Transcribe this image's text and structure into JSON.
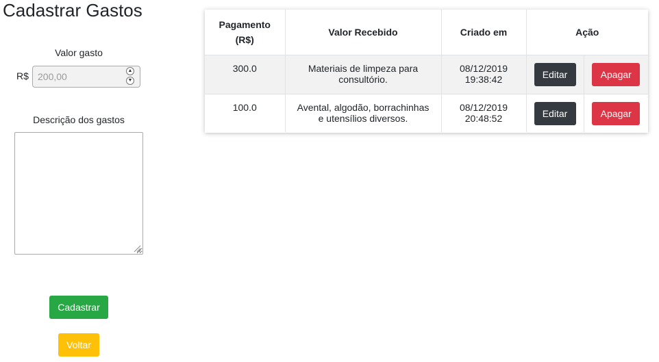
{
  "page": {
    "title": "Cadastrar Gastos"
  },
  "form": {
    "valor_label": "Valor gasto",
    "currency_prefix": "R$",
    "valor_placeholder": "200,00",
    "descricao_label": "Descrição dos gastos",
    "submit_label": "Cadastrar",
    "back_label": "Voltar"
  },
  "table": {
    "headers": {
      "pagamento_line1": "Pagamento",
      "pagamento_line2": "(R$)",
      "valor": "Valor Recebido",
      "criado": "Criado em",
      "acao": "Ação"
    },
    "rows": [
      {
        "pagamento": "300.0",
        "valor_line1": "Materiais de limpeza para",
        "valor_line2": "consultório.",
        "data": "08/12/2019",
        "hora": "19:38:42",
        "edit_label": "Editar",
        "delete_label": "Apagar"
      },
      {
        "pagamento": "100.0",
        "valor_line1": "Avental, algodão, borrachinhas",
        "valor_line2": "e utensílios diversos.",
        "data": "08/12/2019",
        "hora": "20:48:52",
        "edit_label": "Editar",
        "delete_label": "Apagar"
      }
    ]
  },
  "colors": {
    "success": "#28a745",
    "warning": "#ffc107",
    "dark": "#343a40",
    "danger": "#dc3545"
  },
  "icons": {
    "spinner_up": "chevron-up-icon",
    "spinner_down": "chevron-down-icon",
    "resize": "resize-grip-icon"
  }
}
